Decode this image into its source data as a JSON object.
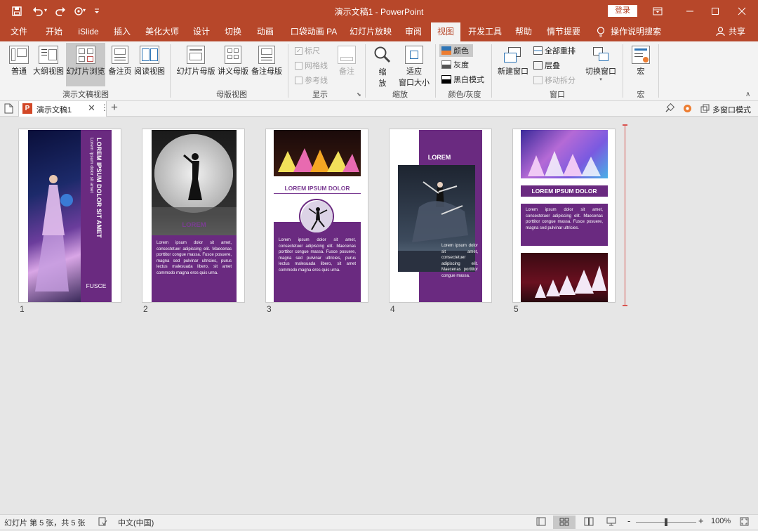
{
  "window": {
    "title": "演示文稿1  -  PowerPoint",
    "login_label": "登录",
    "controls": {
      "ribbon_display": "ribbon-display-icon",
      "minimize": "minimize-icon",
      "maximize": "maximize-icon",
      "close": "close-icon"
    }
  },
  "quick_access": {
    "items": [
      "save-icon",
      "undo-icon",
      "redo-icon",
      "touch-mode-icon",
      "customize-dropdown-icon"
    ]
  },
  "ribbon_tabs": {
    "items": [
      "文件",
      "开始",
      "iSlide",
      "插入",
      "美化大师",
      "设计",
      "切换",
      "动画",
      "口袋动画 PA",
      "幻灯片放映",
      "审阅",
      "视图",
      "开发工具",
      "帮助",
      "情节提要"
    ],
    "active": "视图",
    "tell_me": "操作说明搜索",
    "share": "共享"
  },
  "ribbon": {
    "presentation_views": {
      "label": "演示文稿视图",
      "buttons": [
        "普通",
        "大纲视图",
        "幻灯片浏览",
        "备注页",
        "阅读视图"
      ],
      "selected": "幻灯片浏览"
    },
    "master_views": {
      "label": "母版视图",
      "buttons": [
        "幻灯片母版",
        "讲义母版",
        "备注母版"
      ]
    },
    "show": {
      "label": "显示",
      "ruler": "标尺",
      "gridlines": "网格线",
      "guides": "参考线",
      "notes": "备注"
    },
    "zoom": {
      "label": "缩放",
      "zoom_btn_line1": "缩",
      "zoom_btn_line2": "放",
      "fit_line1": "适应",
      "fit_line2": "窗口大小"
    },
    "color_gray": {
      "label": "颜色/灰度",
      "color": "颜色",
      "grayscale": "灰度",
      "black_white": "黑白模式",
      "selected": "颜色"
    },
    "window": {
      "label": "窗口",
      "new_window": "新建窗口",
      "arrange_all": "全部重排",
      "cascade": "层叠",
      "move_split": "移动拆分",
      "switch_windows": "切换窗口"
    },
    "macros": {
      "label": "宏",
      "button": "宏"
    }
  },
  "doc_tabs": {
    "active_tab": "演示文稿1",
    "add": "+",
    "multi_window": "多窗口模式"
  },
  "slides": [
    {
      "number": "1",
      "title": "LOREM IPSUM DOLOR SIT AMET",
      "subtitle": "Lorem ipsum dolor sit amet",
      "footer": "FUSCE"
    },
    {
      "number": "2",
      "title": "LOREM",
      "body": "Lorem ipsum dolor sit amet, consectetuer adipiscing elit. Maecenas porttitor congue massa. Fusce posuere, magna sed pulvinar ultricies, purus lectus malesuada libero, sit amet commodo magna eros quis urna."
    },
    {
      "number": "3",
      "title": "LOREM IPSUM DOLOR",
      "body": "Lorem ipsum dolor sit amet, consectetuer adipiscing elit. Maecenas porttitor congue massa. Fusce posuere, magna sed pulvinar ultricies, purus lectus malesuada libero, sit amet commodo magna eros quis urna."
    },
    {
      "number": "4",
      "title": "LOREM",
      "body": "Lorem ipsum dolor sit amet, consectetuer adipiscing elit. Maecenas porttitor congue massa."
    },
    {
      "number": "5",
      "title": "LOREM IPSUM DOLOR",
      "body": "Lorem ipsum dolor sit amet, consectetuer adipiscing elit. Maecenas porttitor congue massa. Fusce posuere, magna sed pulvinar ultricies."
    }
  ],
  "status": {
    "slide_info": "幻灯片 第 5 张，共 5 张",
    "language": "中文(中国)",
    "zoom_level": "100%",
    "zoom_fraction": 0.5,
    "zoom_minus": "-",
    "zoom_plus": "+"
  },
  "colors": {
    "brand": "#b7472a",
    "slide_purple": "#6a2a80",
    "insertion_marker": "#d9534f"
  }
}
